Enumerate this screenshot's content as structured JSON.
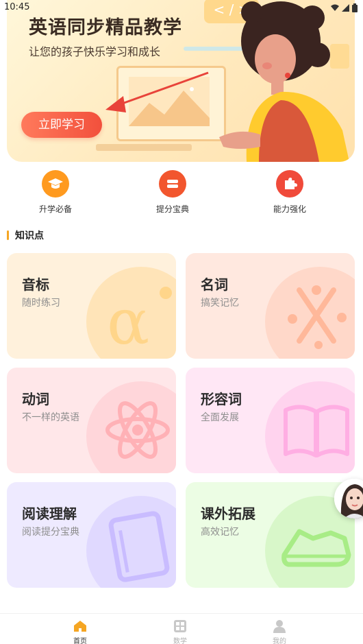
{
  "status_bar": {
    "time": "10:45",
    "icons": [
      "wifi-icon",
      "signal-icon",
      "battery-icon"
    ]
  },
  "banner": {
    "title": "英语同步精品教学",
    "subtitle": "让您的孩子快乐学习和成长",
    "code_badge": "< / >",
    "cta_label": "立即学习"
  },
  "quick_entries": [
    {
      "label": "升学必备",
      "icon": "graduation-cap-icon",
      "color": "#ff9a1f"
    },
    {
      "label": "提分宝典",
      "icon": "book-stack-icon",
      "color": "#f2562e"
    },
    {
      "label": "能力强化",
      "icon": "puzzle-icon",
      "color": "#f04a3a"
    }
  ],
  "section": {
    "title": "知识点",
    "accent": "#f5a623"
  },
  "cards": [
    {
      "title": "音标",
      "subtitle": "随时练习",
      "icon": "alpha-icon",
      "bg": "#fff1dc",
      "circle": "#ffe4b8",
      "art": "#ffd58a"
    },
    {
      "title": "名词",
      "subtitle": "搞笑记忆",
      "icon": "sparkle-icon",
      "bg": "#ffe8df",
      "circle": "#ffd8c9",
      "art": "#ffb89a"
    },
    {
      "title": "动词",
      "subtitle": "不一样的英语",
      "icon": "atom-icon",
      "bg": "#ffe7e9",
      "circle": "#ffd6da",
      "art": "#ffb1b6"
    },
    {
      "title": "形容词",
      "subtitle": "全面发展",
      "icon": "open-book-icon",
      "bg": "#ffe7f5",
      "circle": "#ffd3ee",
      "art": "#ffaee3"
    },
    {
      "title": "阅读理解",
      "subtitle": "阅读提分宝典",
      "icon": "notebook-icon",
      "bg": "#eeeaff",
      "circle": "#e0d9ff",
      "art": "#c9bcff"
    },
    {
      "title": "课外拓展",
      "subtitle": "高效记忆",
      "icon": "sneaker-icon",
      "bg": "#ecfde4",
      "circle": "#d8f7c9",
      "art": "#a8ec86"
    }
  ],
  "bottom_nav": [
    {
      "label": "首页",
      "icon": "home-icon",
      "active": true,
      "color": "#f5a623"
    },
    {
      "label": "数学",
      "icon": "grid-icon",
      "active": false,
      "color": "#c8c8c8"
    },
    {
      "label": "我的",
      "icon": "user-icon",
      "active": false,
      "color": "#c8c8c8"
    }
  ]
}
